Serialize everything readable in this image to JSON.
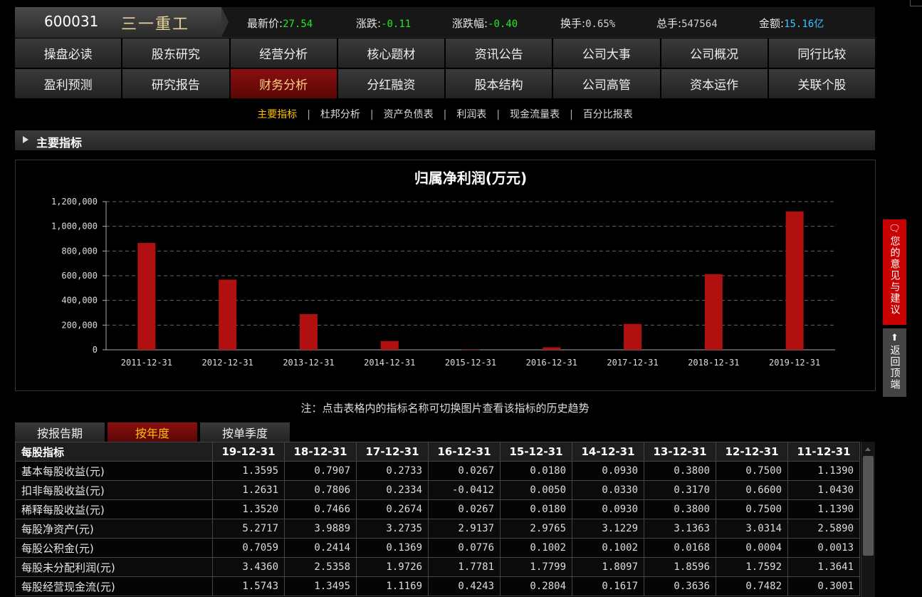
{
  "stock": {
    "code": "600031",
    "name": "三一重工"
  },
  "quotes": [
    {
      "label": "最新价:",
      "value": "27.54",
      "color": "green"
    },
    {
      "label": "涨跌:",
      "value": "-0.11",
      "color": "green"
    },
    {
      "label": "涨跌幅:",
      "value": "-0.40",
      "color": "green"
    },
    {
      "label": "换手:",
      "value": "0.65%",
      "color": "dim"
    },
    {
      "label": "总手:",
      "value": "547564",
      "color": "dim"
    },
    {
      "label": "金额:",
      "value": "15.16亿",
      "color": "cyan"
    }
  ],
  "nav_row1": [
    "操盘必读",
    "股东研究",
    "经营分析",
    "核心题材",
    "资讯公告",
    "公司大事",
    "公司概况",
    "同行比较"
  ],
  "nav_row2": [
    "盈利预测",
    "研究报告",
    "财务分析",
    "分红融资",
    "股本结构",
    "公司高管",
    "资本运作",
    "关联个股"
  ],
  "nav_active": "财务分析",
  "subtabs": [
    "主要指标",
    "杜邦分析",
    "资产负债表",
    "利润表",
    "现金流量表",
    "百分比报表"
  ],
  "subtab_active": "主要指标",
  "section_title": "主要指标",
  "chart_data": {
    "type": "bar",
    "title": "归属净利润(万元)",
    "categories": [
      "2011-12-31",
      "2012-12-31",
      "2013-12-31",
      "2014-12-31",
      "2015-12-31",
      "2016-12-31",
      "2017-12-31",
      "2018-12-31",
      "2019-12-31"
    ],
    "values": [
      865000,
      568000,
      289000,
      71000,
      1500,
      20000,
      209000,
      612000,
      1120000
    ],
    "ylim": [
      0,
      1200000
    ],
    "yticks": [
      "1,200,000",
      "1,000,000",
      "800,000",
      "600,000",
      "400,000",
      "200,000",
      "0"
    ],
    "grid": true,
    "bar_color": "#b01010"
  },
  "note": "注：点击表格内的指标名称可切换图片查看该指标的历史趋势",
  "table_tabs": [
    "按报告期",
    "按年度",
    "按单季度"
  ],
  "table_tab_active": "按年度",
  "table": {
    "header": "每股指标",
    "columns": [
      "19-12-31",
      "18-12-31",
      "17-12-31",
      "16-12-31",
      "15-12-31",
      "14-12-31",
      "13-12-31",
      "12-12-31",
      "11-12-31"
    ],
    "rows": [
      {
        "name": "基本每股收益(元)",
        "values": [
          "1.3595",
          "0.7907",
          "0.2733",
          "0.0267",
          "0.0180",
          "0.0930",
          "0.3800",
          "0.7500",
          "1.1390"
        ]
      },
      {
        "name": "扣非每股收益(元)",
        "values": [
          "1.2631",
          "0.7806",
          "0.2334",
          "-0.0412",
          "0.0050",
          "0.0330",
          "0.3170",
          "0.6600",
          "1.0430"
        ]
      },
      {
        "name": "稀释每股收益(元)",
        "values": [
          "1.3520",
          "0.7466",
          "0.2674",
          "0.0267",
          "0.0180",
          "0.0930",
          "0.3800",
          "0.7500",
          "1.1390"
        ]
      },
      {
        "name": "每股净资产(元)",
        "values": [
          "5.2717",
          "3.9889",
          "3.2735",
          "2.9137",
          "2.9765",
          "3.1229",
          "3.1363",
          "3.0314",
          "2.5890"
        ]
      },
      {
        "name": "每股公积金(元)",
        "values": [
          "0.7059",
          "0.2414",
          "0.1369",
          "0.0776",
          "0.1002",
          "0.1002",
          "0.0168",
          "0.0004",
          "0.0013"
        ]
      },
      {
        "name": "每股未分配利润(元)",
        "values": [
          "3.4360",
          "2.5358",
          "1.9726",
          "1.7781",
          "1.7799",
          "1.8097",
          "1.8596",
          "1.7592",
          "1.3641"
        ]
      },
      {
        "name": "每股经营现金流(元)",
        "values": [
          "1.5743",
          "1.3495",
          "1.1169",
          "0.4243",
          "0.2804",
          "0.1617",
          "0.3636",
          "0.7482",
          "0.3001"
        ]
      }
    ]
  },
  "side": {
    "feedback": "您的意见与建议",
    "top": "返回顶端",
    "feedback_icon": "comment-icon",
    "top_icon": "arrow-up-icon"
  }
}
